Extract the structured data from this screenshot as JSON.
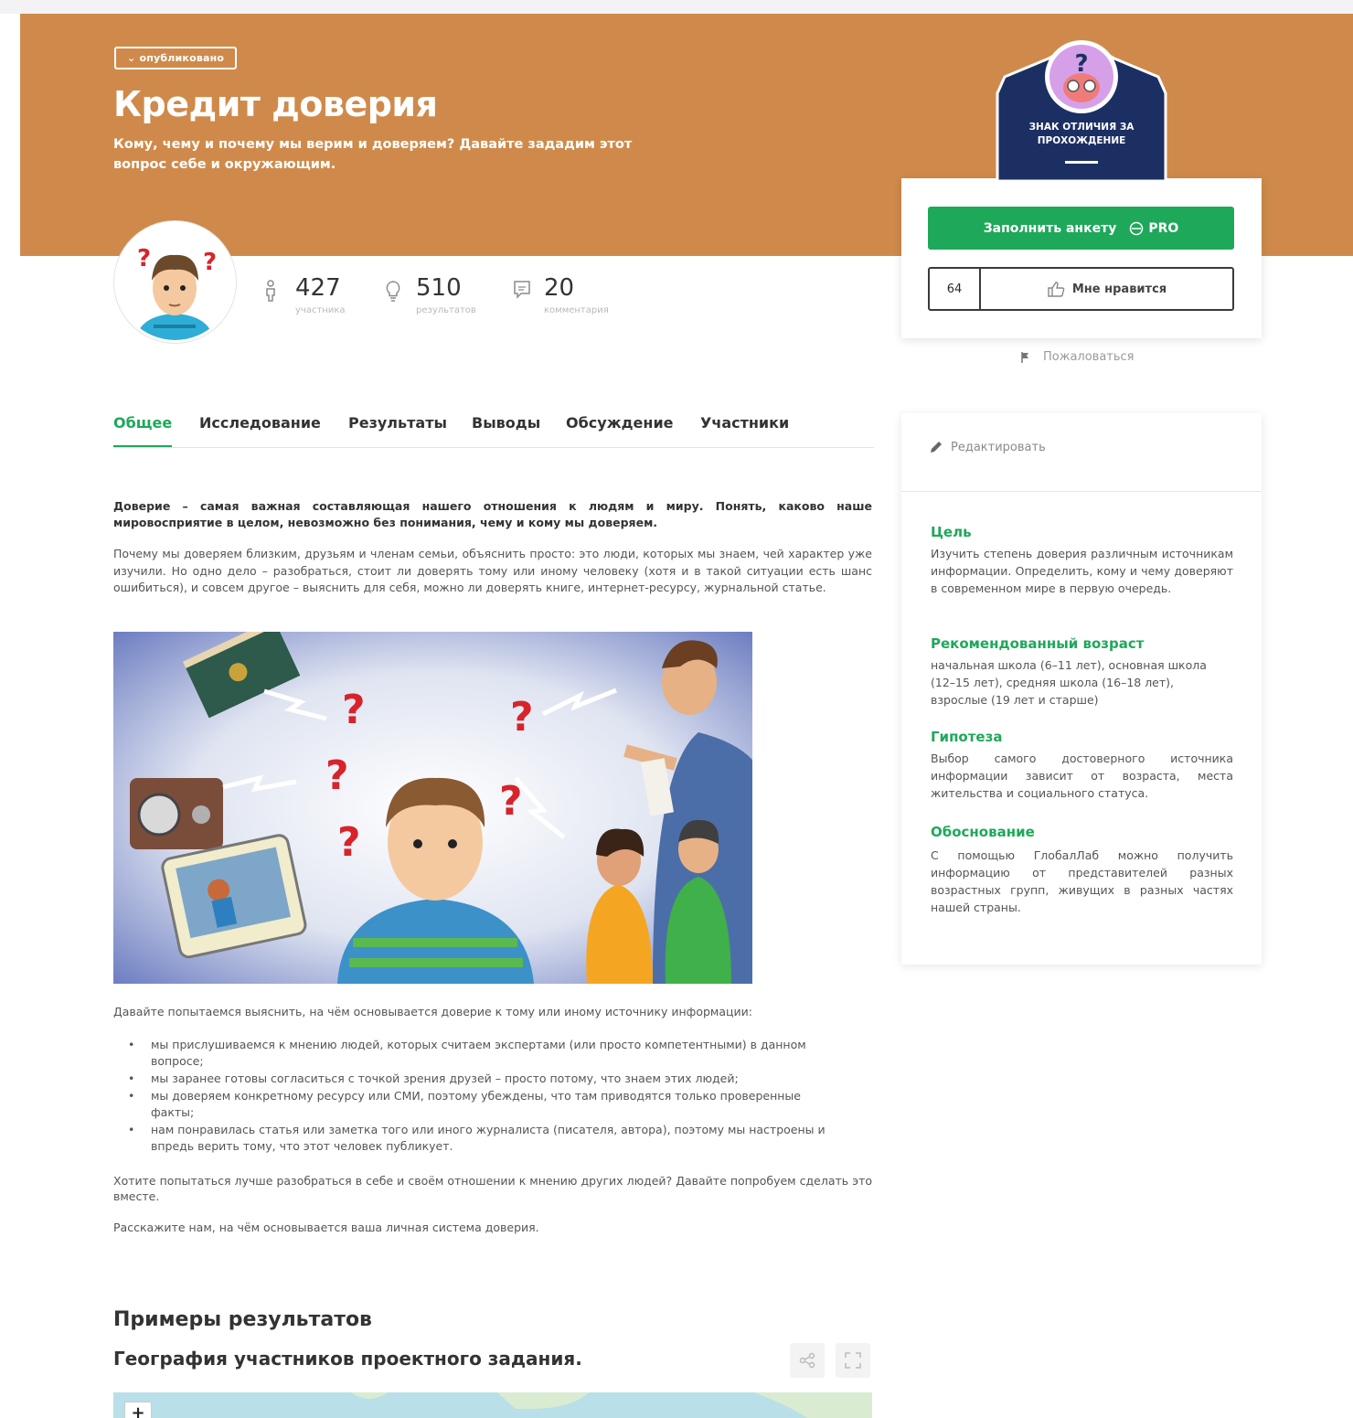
{
  "project": {
    "status": "опубликовано",
    "title": "Кредит доверия",
    "subtitle": "Кому, чему и почему мы верим и доверяем? Давайте зададим этот вопрос себе и окружающим."
  },
  "stats": [
    {
      "icon": "person-icon",
      "value": "427",
      "label": "участника"
    },
    {
      "icon": "lightbulb-icon",
      "value": "510",
      "label": "результатов"
    },
    {
      "icon": "comment-icon",
      "value": "20",
      "label": "комментария"
    }
  ],
  "badge": {
    "text": "ЗНАК ОТЛИЧИЯ ЗА ПРОХОЖДЕНИЕ"
  },
  "actions": {
    "fill_form": "Заполнить анкету",
    "pro": "PRO",
    "like_count": "64",
    "like_label": "Мне нравится",
    "report": "Пожаловаться"
  },
  "tabs": [
    "Общее",
    "Исследование",
    "Результаты",
    "Выводы",
    "Обсуждение",
    "Участники"
  ],
  "content": {
    "lead": "Доверие – самая важная составляющая нашего отношения к людям и миру. Понять, каково наше мировосприятие в целом, невозможно без понимания, чему и кому мы доверяем.",
    "para1": "Почему мы доверяем близким, друзьям и членам семьи, объяснить просто: это люди, которых мы знаем, чей характер уже изучили. Но одно дело – разобраться, стоит ли доверять тому или иному человеку (хотя и в такой ситуации есть шанс ошибиться), и совсем другое – выяснить для себя, можно ли доверять книге, интернет-ресурсу, журнальной статье.",
    "intro": "Давайте попытаемся выяснить, на чём основывается доверие к тому или иному источнику информации:",
    "reasons": [
      "мы прислушиваемся к мнению людей, которых считаем экспертами (или просто компетентными) в данном вопросе;",
      "мы заранее готовы согласиться с точкой зрения друзей – просто потому, что знаем этих людей;",
      "мы доверяем конкретному ресурсу или СМИ, поэтому убеждены, что там приводятся только проверенные факты;",
      "нам понравилась статья или заметка того или иного журналиста (писателя, автора), поэтому мы настроены и впредь верить тому, что этот человек публикует."
    ],
    "para2": "Хотите попытаться лучше разобраться в себе и своём отношении к мнению других людей? Давайте попробуем сделать это вместе.",
    "para3": "Расскажите нам, на чём основывается ваша личная система доверия."
  },
  "results": {
    "title": "Примеры результатов",
    "map_title": "География участников проектного задания.",
    "zoom_in": "+"
  },
  "sidebar": {
    "edit": "Редактировать",
    "sections": [
      {
        "heading": "Цель",
        "text": "Изучить степень доверия различным источникам информации. Определить, кому и чему доверяют в современном мире в первую очередь."
      },
      {
        "heading": "Рекомендованный возраст",
        "text": "начальная школа (6–11 лет), основная школа (12–15 лет), средняя школа (16–18 лет), взрослые (19 лет и старше)"
      },
      {
        "heading": "Гипотеза",
        "text": "Выбор самого достоверного источника информации зависит от возраста, места жительства и социального статуса."
      },
      {
        "heading": "Обоснование",
        "text": "С помощью ГлобалЛаб можно получить информацию от представителей разных возрастных групп, живущих в разных частях нашей страны."
      }
    ]
  },
  "colors": {
    "hero": "#cf8a4b",
    "accent": "#1ea85a",
    "badge": "#1c2f63"
  }
}
